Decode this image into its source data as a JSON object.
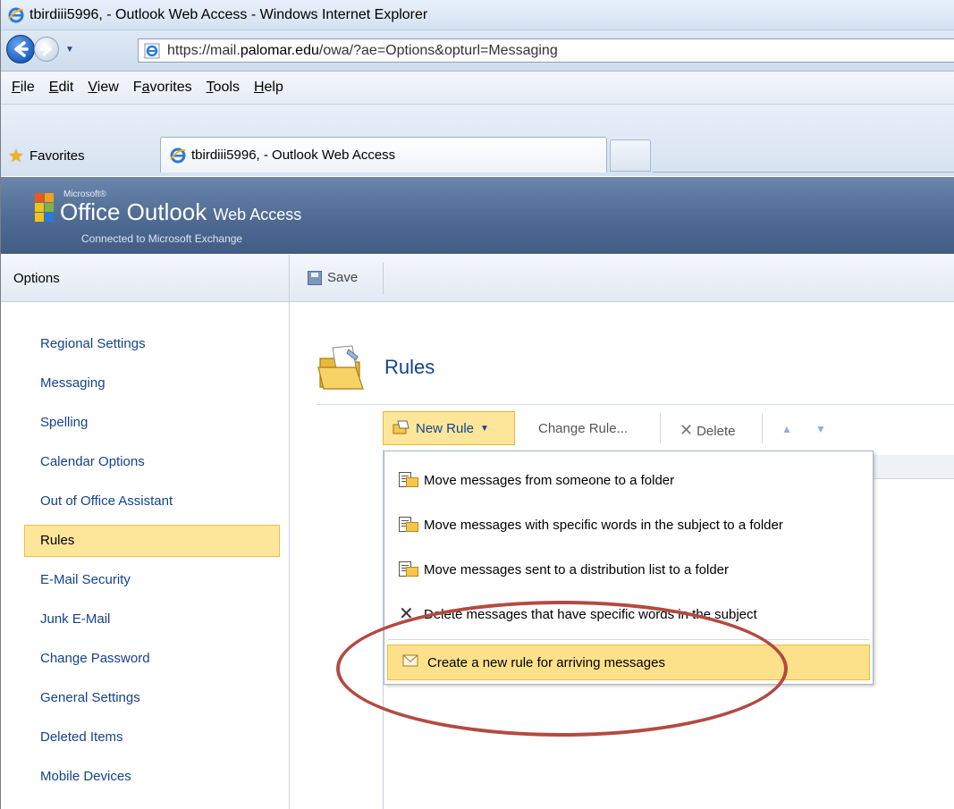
{
  "browser": {
    "window_title": "tbirdiii5996, - Outlook Web Access - Windows Internet Explorer",
    "address": {
      "prefix": "https://mail.",
      "domain": "palomar.edu",
      "path": "/owa/?ae=Options&opturl=Messaging"
    },
    "menu": [
      {
        "accel": "F",
        "rest": "ile"
      },
      {
        "accel": "E",
        "rest": "dit"
      },
      {
        "accel": "V",
        "rest": "iew"
      },
      {
        "pre": "F",
        "accel": "a",
        "rest": "vorites"
      },
      {
        "accel": "T",
        "rest": "ools"
      },
      {
        "accel": "H",
        "rest": "elp"
      }
    ],
    "favorites_label": "Favorites",
    "active_tab": "tbirdiii5996, - Outlook Web Access"
  },
  "owa": {
    "brand_microsoft": "Microsoft®",
    "brand_office": "Office Outlook",
    "brand_webaccess": "Web Access",
    "brand_sub": "Connected to Microsoft Exchange"
  },
  "sidebar": {
    "header": "Options",
    "items": [
      {
        "label": "Regional Settings"
      },
      {
        "label": "Messaging"
      },
      {
        "label": "Spelling"
      },
      {
        "label": "Calendar Options"
      },
      {
        "label": "Out of Office Assistant"
      },
      {
        "label": "Rules",
        "selected": true
      },
      {
        "label": "E-Mail Security"
      },
      {
        "label": "Junk E-Mail"
      },
      {
        "label": "Change Password"
      },
      {
        "label": "General Settings"
      },
      {
        "label": "Deleted Items"
      },
      {
        "label": "Mobile Devices"
      }
    ]
  },
  "toolbar": {
    "save_label": "Save"
  },
  "rules": {
    "title": "Rules",
    "new_rule": "New Rule",
    "change_rule": "Change Rule...",
    "delete": "Delete",
    "menu": [
      "Move messages from someone to a folder",
      "Move messages with specific words in the subject to a folder",
      "Move messages sent to a distribution list to a folder",
      "Delete messages that have specific words in the subject",
      "Create a new rule for arriving messages"
    ]
  },
  "colors": {
    "link_blue": "#15428b",
    "highlight": "#fde69a",
    "annotation_circle": "#b34a42"
  }
}
